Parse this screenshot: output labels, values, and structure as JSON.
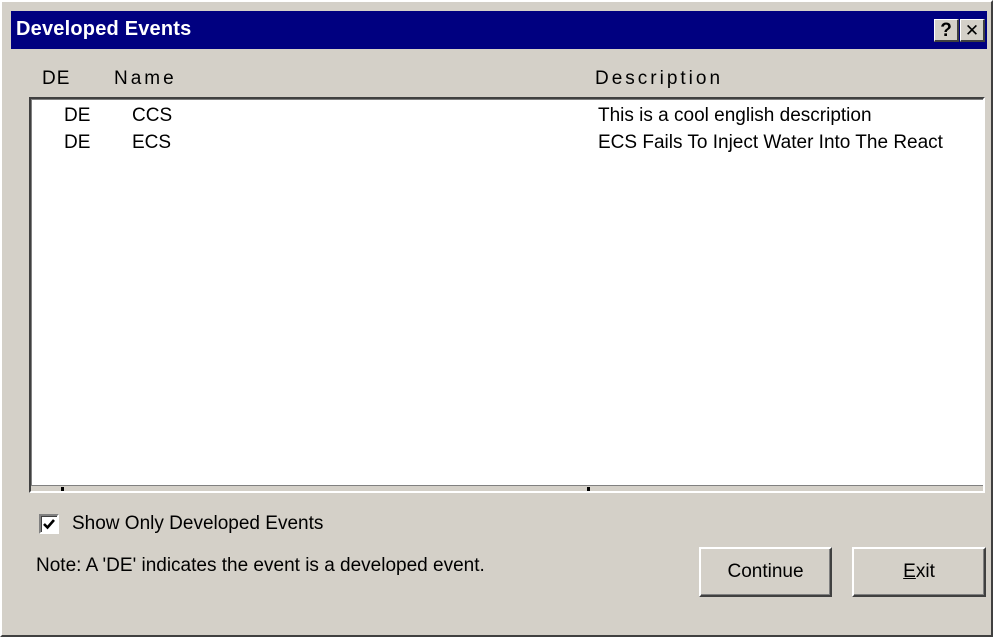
{
  "window": {
    "title": "Developed Events",
    "help_glyph": "?",
    "close_glyph": "✕"
  },
  "columns": {
    "de": "DE",
    "name": "Name",
    "description": "Description"
  },
  "rows": [
    {
      "de": "DE",
      "name": "CCS",
      "description": "This is a cool english description"
    },
    {
      "de": "DE",
      "name": "ECS",
      "description": "ECS Fails To Inject Water Into The React"
    }
  ],
  "options": {
    "show_only_developed_label": "Show Only Developed Events",
    "show_only_developed_checked": true
  },
  "note": "Note: A 'DE' indicates the event is a developed event.",
  "buttons": {
    "continue_label": "Continue",
    "exit_accel": "E",
    "exit_rest": "xit"
  },
  "icons": {
    "help": "help-icon",
    "close": "close-icon",
    "check": "checkmark-icon"
  },
  "colors": {
    "titlebar": "#000080",
    "face": "#d4d0c8",
    "list_bg": "#ffffff"
  }
}
